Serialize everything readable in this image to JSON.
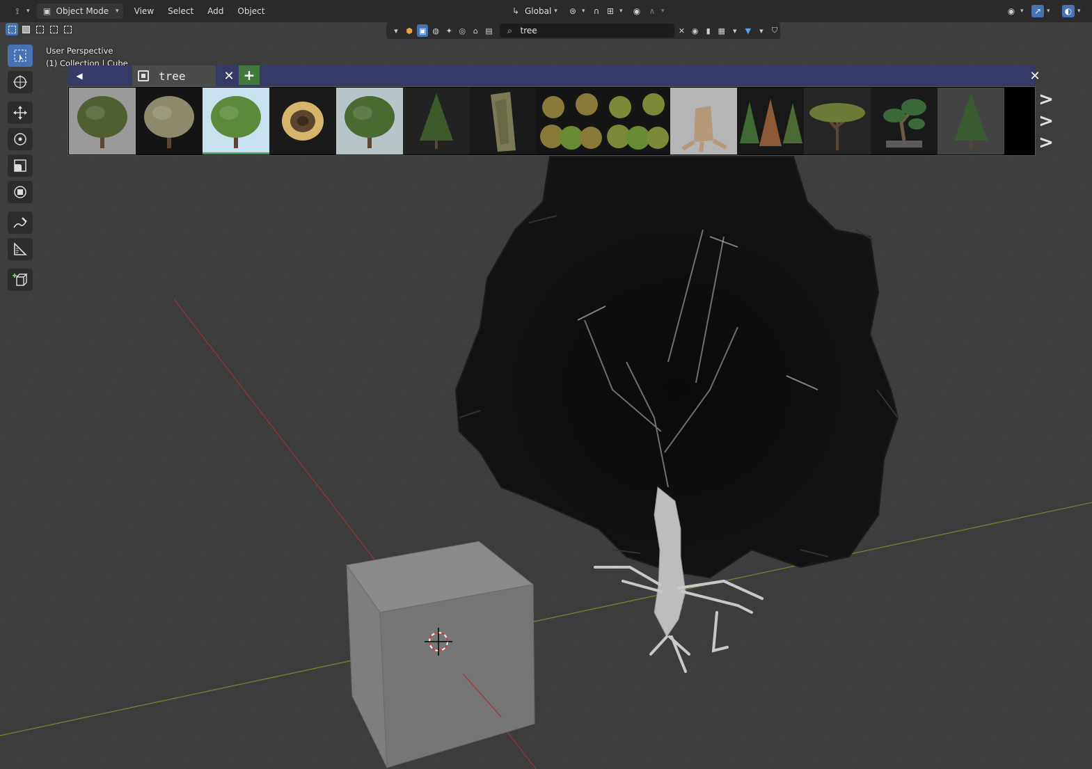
{
  "header": {
    "editor_type_icon": "axis-icon",
    "mode_label": "Object Mode",
    "menus": [
      "View",
      "Select",
      "Add",
      "Object"
    ],
    "orientation_label": "Global"
  },
  "search": {
    "value": "tree",
    "placeholder": ""
  },
  "viewport": {
    "title": "User Perspective",
    "subtitle": "(1) Collection | Cube"
  },
  "asset_browser": {
    "tab_label": "tree",
    "thumbnails": [
      {
        "name": "olive-tree-thumbnail",
        "bg": "#9a9a9a",
        "kind": "broad",
        "foliage": "#4f5f30"
      },
      {
        "name": "pale-tree-thumbnail",
        "bg": "#151515",
        "kind": "broad",
        "foliage": "#8d8a6c"
      },
      {
        "name": "oak-tree-thumbnail",
        "bg": "#c9e0ee",
        "kind": "broad",
        "foliage": "#5d8a3a",
        "selected": true
      },
      {
        "name": "tree-slice-thumbnail",
        "bg": "#1a1a1a",
        "kind": "slice",
        "foliage": "#d6b46a"
      },
      {
        "name": "meadow-tree-thumbnail",
        "bg": "#b7c4c8",
        "kind": "broad",
        "foliage": "#4a6a32"
      },
      {
        "name": "conifer-dark-thumbnail",
        "bg": "#222222",
        "kind": "conifer",
        "foliage": "#3e5a2c"
      },
      {
        "name": "bark-log-thumbnail",
        "bg": "#1a1a1a",
        "kind": "log",
        "foliage": "#7c7a55"
      },
      {
        "name": "tree-pack-thumbnail-a",
        "bg": "#151515",
        "kind": "cluster",
        "foliage": "#8a7a3a"
      },
      {
        "name": "tree-pack-thumbnail-b",
        "bg": "#151515",
        "kind": "cluster",
        "foliage": "#7c8a38"
      },
      {
        "name": "tree-stump-thumbnail",
        "bg": "#b5b5b5",
        "kind": "stump",
        "foliage": "#b59a7a"
      },
      {
        "name": "autumn-trees-thumbnail",
        "bg": "#181818",
        "kind": "trio",
        "foliage": "#8b5a34"
      },
      {
        "name": "acacia-tree-thumbnail",
        "bg": "#262626",
        "kind": "flat",
        "foliage": "#6b7a36"
      },
      {
        "name": "bonsai-tree-thumbnail",
        "bg": "#1a1a1a",
        "kind": "bonsai",
        "foliage": "#3a6a3a"
      },
      {
        "name": "pine-tree-thumbnail",
        "bg": "#444444",
        "kind": "conifer",
        "foliage": "#3b5b33"
      }
    ]
  },
  "colors": {
    "accent": "#4772b3",
    "asset_bar": "#353a66",
    "add_button": "#3f7a3c",
    "x_axis": "#b23a3a",
    "y_axis": "#6b8a2e"
  }
}
